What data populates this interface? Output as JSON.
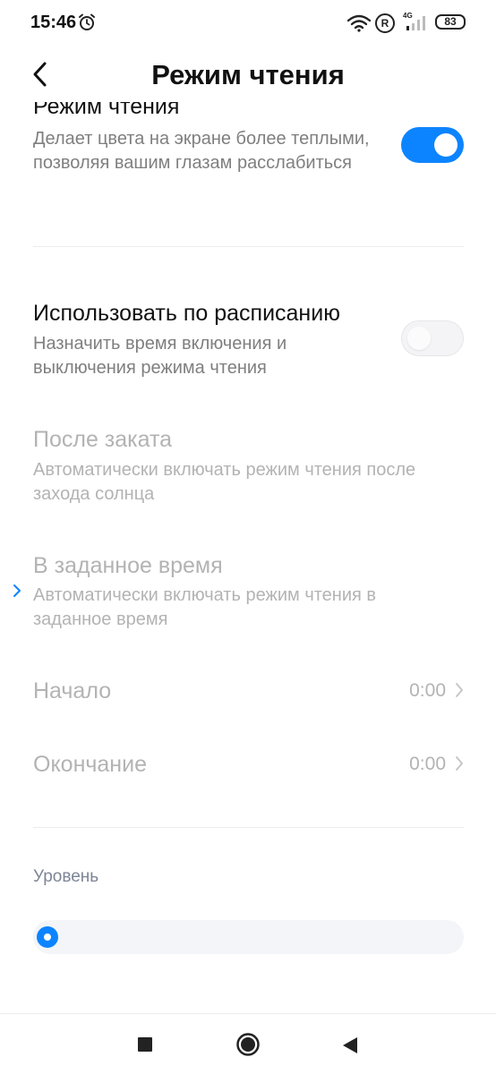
{
  "status_bar": {
    "time": "15:46",
    "roaming_badge": "R",
    "network_type": "4G",
    "battery": "83",
    "icons": [
      "alarm-icon",
      "wifi-icon",
      "signal-icon"
    ]
  },
  "header": {
    "title": "Режим чтения",
    "back_icon": "chevron-left-icon"
  },
  "reading_mode": {
    "title": "Режим чтения",
    "subtitle": "Делает цвета на экране более теплыми, позволяя вашим глазам расслабиться",
    "enabled": true
  },
  "schedule": {
    "title": "Использовать по расписанию",
    "subtitle": "Назначить время включения и выключения режима чтения",
    "enabled": false
  },
  "after_sunset": {
    "title": "После заката",
    "subtitle": "Автоматически включать режим чтения после захода солнца"
  },
  "custom_time": {
    "title": "В заданное время",
    "subtitle": "Автоматически включать режим чтения в заданное время"
  },
  "start": {
    "label": "Начало",
    "value": "0:00"
  },
  "end": {
    "label": "Окончание",
    "value": "0:00"
  },
  "level": {
    "label": "Уровень",
    "value_fraction": 0
  },
  "colors": {
    "accent": "#0d84ff",
    "disabled_text": "#b3b3b3",
    "secondary_text": "#7f7f7f"
  },
  "nav_bar": {
    "icons": [
      "recents-square-icon",
      "home-circle-icon",
      "back-triangle-icon"
    ]
  }
}
